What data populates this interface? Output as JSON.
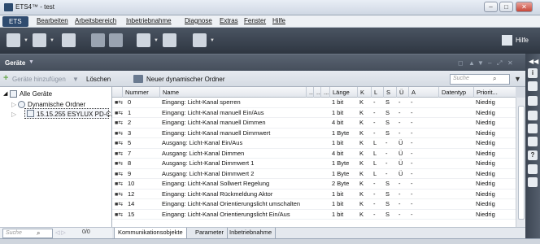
{
  "window": {
    "title": "ETS4™ - test",
    "minimize": "–",
    "maximize": "□",
    "close": "✕"
  },
  "menubar": {
    "items": [
      "ETS",
      "Bearbeiten",
      "Arbeitsbereich",
      "Inbetriebnahme",
      "Diagnose",
      "Extras",
      "Fenster",
      "Hilfe"
    ]
  },
  "toolbar": {
    "help": "Hilfe"
  },
  "panel": {
    "title": "Geräte",
    "add_device": "Geräte hinzufügen",
    "delete": "Löschen",
    "new_dynamic_folder": "Neuer dynamischer Ordner",
    "search_placeholder": "Suche"
  },
  "tree": {
    "items": [
      "Alle Geräte",
      "Dynamische Ordner",
      "15.15.255  ESYLUX PD-C..."
    ],
    "search_placeholder": "Suche",
    "count": "0/0"
  },
  "grid": {
    "columns": [
      "Nummer",
      "Name",
      "...",
      "...",
      "...",
      "Länge",
      "K",
      "L",
      "S",
      "Ü",
      "A",
      "Datentyp",
      "Priorit..."
    ],
    "rows": [
      [
        "0",
        "Eingang: Licht-Kanal sperren",
        "1 bit",
        "K",
        "-",
        "S",
        "-",
        "-",
        "",
        "Niedrig"
      ],
      [
        "1",
        "Eingang: Licht-Kanal manuell Ein/Aus",
        "1 bit",
        "K",
        "-",
        "S",
        "-",
        "-",
        "",
        "Niedrig"
      ],
      [
        "2",
        "Eingang: Licht-Kanal manuell Dimmen",
        "4 bit",
        "K",
        "-",
        "S",
        "-",
        "-",
        "",
        "Niedrig"
      ],
      [
        "3",
        "Eingang: Licht-Kanal manuell Dimmwert",
        "1 Byte",
        "K",
        "-",
        "S",
        "-",
        "-",
        "",
        "Niedrig"
      ],
      [
        "5",
        "Ausgang: Licht-Kanal Ein/Aus",
        "1 bit",
        "K",
        "L",
        "-",
        "Ü",
        "-",
        "",
        "Niedrig"
      ],
      [
        "7",
        "Ausgang: Licht-Kanal Dimmen",
        "4 bit",
        "K",
        "L",
        "-",
        "Ü",
        "-",
        "",
        "Niedrig"
      ],
      [
        "8",
        "Ausgang: Licht-Kanal Dimmwert 1",
        "1 Byte",
        "K",
        "L",
        "-",
        "Ü",
        "-",
        "",
        "Niedrig"
      ],
      [
        "9",
        "Ausgang: Licht-Kanal Dimmwert 2",
        "1 Byte",
        "K",
        "L",
        "-",
        "Ü",
        "-",
        "",
        "Niedrig"
      ],
      [
        "10",
        "Eingang: Licht-Kanal Sollwert Regelung",
        "2 Byte",
        "K",
        "-",
        "S",
        "-",
        "-",
        "",
        "Niedrig"
      ],
      [
        "12",
        "Eingang: Licht-Kanal Rückmeldung Aktor",
        "1 bit",
        "K",
        "-",
        "S",
        "-",
        "-",
        "",
        "Niedrig"
      ],
      [
        "14",
        "Eingang: Licht-Kanal Orientierungslicht umschalten",
        "1 bit",
        "K",
        "-",
        "S",
        "-",
        "-",
        "",
        "Niedrig"
      ],
      [
        "15",
        "Eingang: Licht-Kanal Orientierungslicht Ein/Aus",
        "1 bit",
        "K",
        "-",
        "S",
        "-",
        "-",
        "",
        "Niedrig"
      ]
    ]
  },
  "tabs": [
    "Kommunikationsobjekte",
    "Parameter",
    "Inbetriebnahme"
  ],
  "icons": {
    "group_object": "group-object-icon"
  }
}
